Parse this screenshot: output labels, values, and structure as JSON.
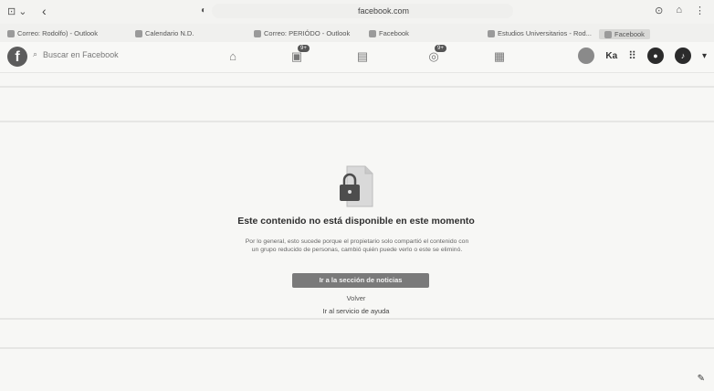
{
  "browser": {
    "url": "facebook.com",
    "bookmarks": [
      "Correo: Rodolfo) - Outlook",
      "Calendario N.D.",
      "Correo: PERIÓDO - Outlook",
      "Facebook",
      "Estudios Universitarios - Rod...",
      "Facebook"
    ]
  },
  "header": {
    "search_placeholder": "Buscar en Facebook",
    "watch_badge": "9+",
    "groups_badge": "9+",
    "profile_initials": "Ka"
  },
  "main": {
    "title": "Este contenido no está disponible en este momento",
    "description": "Por lo general, esto sucede porque el propietario solo compartió el contenido con un grupo reducido de personas, cambió quién puede verlo o este se eliminó.",
    "primary_button": "Ir a la sección de noticias",
    "back_link": "Volver",
    "help_link": "Ir al servicio de ayuda"
  }
}
